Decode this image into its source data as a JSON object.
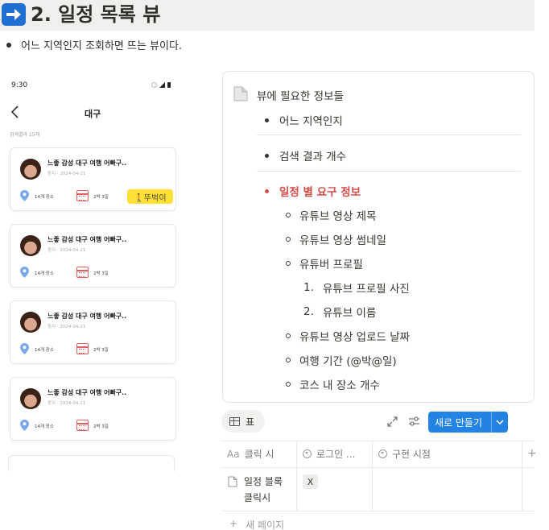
{
  "header": {
    "title": "2. 일정 목록 뷰",
    "description": "어느 지역인지 조회하면 뜨는 뷰이다.",
    "icon": "right-arrow-icon",
    "header_bg": "#efefed",
    "icon_color": "#1f6fd0"
  },
  "phone": {
    "status_time": "9:30",
    "title": "대구",
    "result_count": "검색결과 15개",
    "cards": [
      {
        "title": "느좋 감성 대구 여행 어빠구..",
        "date": "등지 · 2024-04-21",
        "places": "14개 장소",
        "days": "2박 3일",
        "tag": "🚶뚜벅이"
      },
      {
        "title": "느좋 감성 대구 여행 어빠구..",
        "date": "등지 · 2024-04-21",
        "places": "14개 장소",
        "days": "2박 3일"
      },
      {
        "title": "느좋 감성 대구 여행 어빠구..",
        "date": "등지 · 2024-04-21",
        "places": "14개 장소",
        "days": "2박 3일"
      },
      {
        "title": "느좋 감성 대구 여행 어빠구..",
        "date": "등지 · 2024-04-21",
        "places": "14개 장소",
        "days": "2박 3일"
      }
    ],
    "tag_color": "#ffe033",
    "pin_color": "#7aa7e8",
    "calendar_color": "#e06060"
  },
  "callout": {
    "title": "뷰에 필요한 정보들",
    "items": {
      "region": "어느 지역인지",
      "count": "검색 결과 개수",
      "required": "일정 별 요구 정보",
      "video_title": "유튜브 영상 제목",
      "thumbnail": "유튜브 영상 썸네일",
      "profile": "유튜버 프로필",
      "profile_photo": "유튜브 프로필 사진",
      "profile_name": "유튜브 이름",
      "upload_date": "유튜브 영상 업로드 날짜",
      "trip_period": "여행 기간 (@박@일)",
      "place_count": "코스 내 장소 개수"
    },
    "numbers": [
      "1.",
      "2."
    ],
    "highlight_color": "#d44c47"
  },
  "toolbar": {
    "view_label": "표",
    "new_button": "새로 만들기",
    "button_color": "#2383e2"
  },
  "table": {
    "headers": [
      "클릭 시",
      "로그인 ...",
      "구현 시점"
    ],
    "rows": [
      {
        "name": "일정 블록\n클릭시",
        "login": "X"
      }
    ],
    "new_page": "새 페이지"
  }
}
